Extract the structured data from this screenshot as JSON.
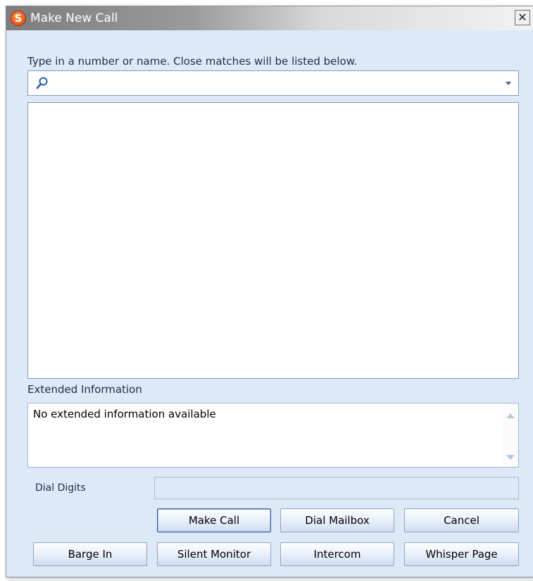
{
  "window": {
    "title": "Make New Call",
    "app_icon_letter": "S",
    "close_glyph": "✕"
  },
  "search": {
    "prompt": "Type in a number or name.  Close matches will be listed below.",
    "value": "",
    "placeholder": ""
  },
  "extended": {
    "label": "Extended Information",
    "text": "No extended information available"
  },
  "dial": {
    "label": "Dial Digits",
    "value": ""
  },
  "buttons": {
    "make_call": "Make Call",
    "dial_mailbox": "Dial Mailbox",
    "cancel": "Cancel",
    "barge_in": "Barge In",
    "silent_monitor": "Silent Monitor",
    "intercom": "Intercom",
    "whisper_page": "Whisper Page"
  },
  "icons": {
    "app": "app-logo-icon",
    "search": "search-icon",
    "dropdown": "chevron-down-icon",
    "close": "close-icon"
  },
  "colors": {
    "dialog_bg": "#dde9f8",
    "border": "#7f9db9",
    "app_icon": "#e0410f"
  }
}
